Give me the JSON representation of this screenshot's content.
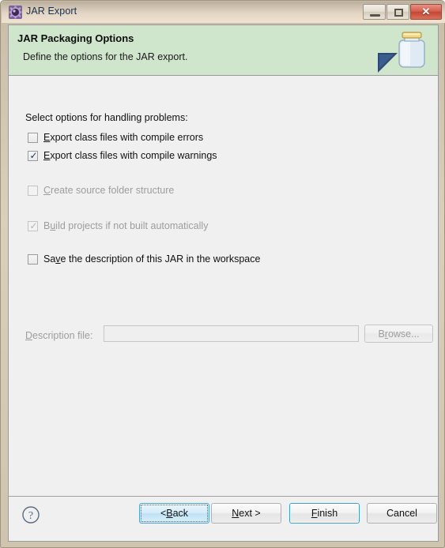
{
  "window": {
    "title": "JAR Export",
    "icon": "eclipse-wizard-icon",
    "controls": {
      "minimize_label": "–",
      "maximize_label": "□",
      "close_label": "✕"
    }
  },
  "banner": {
    "title": "JAR Packaging Options",
    "description": "Define the options for the JAR export.",
    "background_color": "#cfe6cc",
    "art_icon": "jar-with-arrow-icon"
  },
  "content": {
    "group_label": "Select options for handling problems:",
    "checkboxes": [
      {
        "name": "export-class-files-compile-errors",
        "label_before": "",
        "mnemonic": "E",
        "label_after": "xport class files with compile errors",
        "checked": false,
        "enabled": true
      },
      {
        "name": "export-class-files-compile-warnings",
        "label_before": "",
        "mnemonic": "E",
        "label_after": "xport class files with compile warnings",
        "checked": true,
        "enabled": true
      },
      {
        "name": "create-source-folder-structure",
        "label_before": "",
        "mnemonic": "C",
        "label_after": "reate source folder structure",
        "checked": false,
        "enabled": false
      },
      {
        "name": "build-projects-if-not-built-automatically",
        "label_before": "B",
        "mnemonic": "u",
        "label_after": "ild projects if not built automatically",
        "checked": true,
        "enabled": false
      },
      {
        "name": "save-description-of-jar-in-workspace",
        "label_before": "Sa",
        "mnemonic": "v",
        "label_after": "e the description of this JAR in the workspace",
        "checked": false,
        "enabled": true
      }
    ],
    "check_glyph": "✓",
    "description_file": {
      "label_before": "",
      "label_mnemonic": "D",
      "label_after": "escription file:",
      "value": "",
      "placeholder": "",
      "enabled": false
    },
    "browse_button": {
      "label_before": "B",
      "mnemonic": "r",
      "label_after": "owse...",
      "enabled": false
    }
  },
  "footer": {
    "help_icon": "help-question-icon",
    "buttons": [
      {
        "name": "back",
        "label_before": "< ",
        "mnemonic": "B",
        "label_after": "ack",
        "state": "focused"
      },
      {
        "name": "next",
        "label_before": "",
        "mnemonic": "N",
        "label_after": "ext >",
        "state": "normal"
      },
      {
        "name": "finish",
        "label_before": "",
        "mnemonic": "F",
        "label_after": "inish",
        "state": "default"
      },
      {
        "name": "cancel",
        "label_before": "Cancel",
        "mnemonic": "",
        "label_after": "",
        "state": "normal"
      }
    ]
  }
}
